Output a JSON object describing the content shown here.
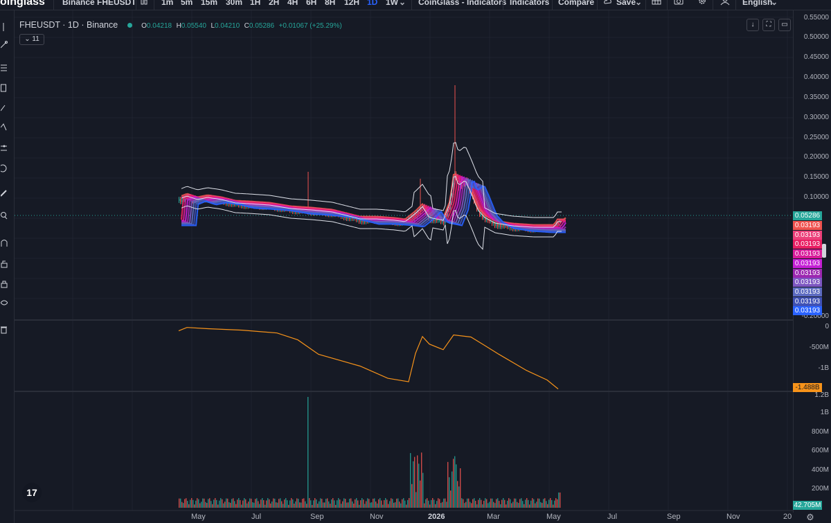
{
  "toolbar": {
    "logo": "oinglass",
    "symbol": "Binance FHEUSDT",
    "timeframes": [
      "1m",
      "5m",
      "15m",
      "30m",
      "1H",
      "2H",
      "4H",
      "6H",
      "8H",
      "12H",
      "1D",
      "1W"
    ],
    "active_timeframe": "1D",
    "coinglass_indicators": "CoinGlass - Indicators",
    "indicators": "Indicators",
    "compare": "Compare",
    "save": "Save",
    "language": "English"
  },
  "legend": {
    "title": "FHEUSDT · 1D · Binance",
    "o_key": "O",
    "o": "0.04218",
    "h_key": "H",
    "h": "0.05540",
    "l_key": "L",
    "l": "0.04210",
    "c_key": "C",
    "c": "0.05286",
    "change": "+0.01067 (+25.29%)",
    "indicator_count": "11"
  },
  "price_scale": {
    "ticks": [
      "0.55000",
      "0.50000",
      "0.45000",
      "0.40000",
      "0.35000",
      "0.30000",
      "0.25000",
      "0.20000",
      "0.15000",
      "0.10000",
      "-0.20000"
    ],
    "last_price": "0.05286",
    "ma_values": [
      "0.03193",
      "0.03193",
      "0.03193",
      "0.03193",
      "0.03193",
      "0.03193",
      "0.03193",
      "0.03193",
      "0.03193",
      "0.03193"
    ],
    "ma_colors": [
      "#ef5350",
      "#ec407a",
      "#e91e63",
      "#d81b9a",
      "#c51fd6",
      "#9c27b0",
      "#7e57c2",
      "#5c6bc0",
      "#3f51b5",
      "#2962ff"
    ]
  },
  "cvd_scale": {
    "ticks": [
      "0",
      "-500M",
      "-1B"
    ],
    "last_value": "-1.488B",
    "color": "#f7931a"
  },
  "volume_scale": {
    "ticks": [
      "1.2B",
      "1B",
      "800M",
      "600M",
      "400M",
      "200M"
    ],
    "last_value": "42.705M"
  },
  "time_axis": [
    "May",
    "Jul",
    "Sep",
    "Nov",
    "2026",
    "Mar",
    "May",
    "Jul",
    "Sep",
    "Nov",
    "20"
  ],
  "colors": {
    "up": "#26a69a",
    "down": "#ef5350",
    "background": "#161a25",
    "bb": "#e0e3eb"
  }
}
